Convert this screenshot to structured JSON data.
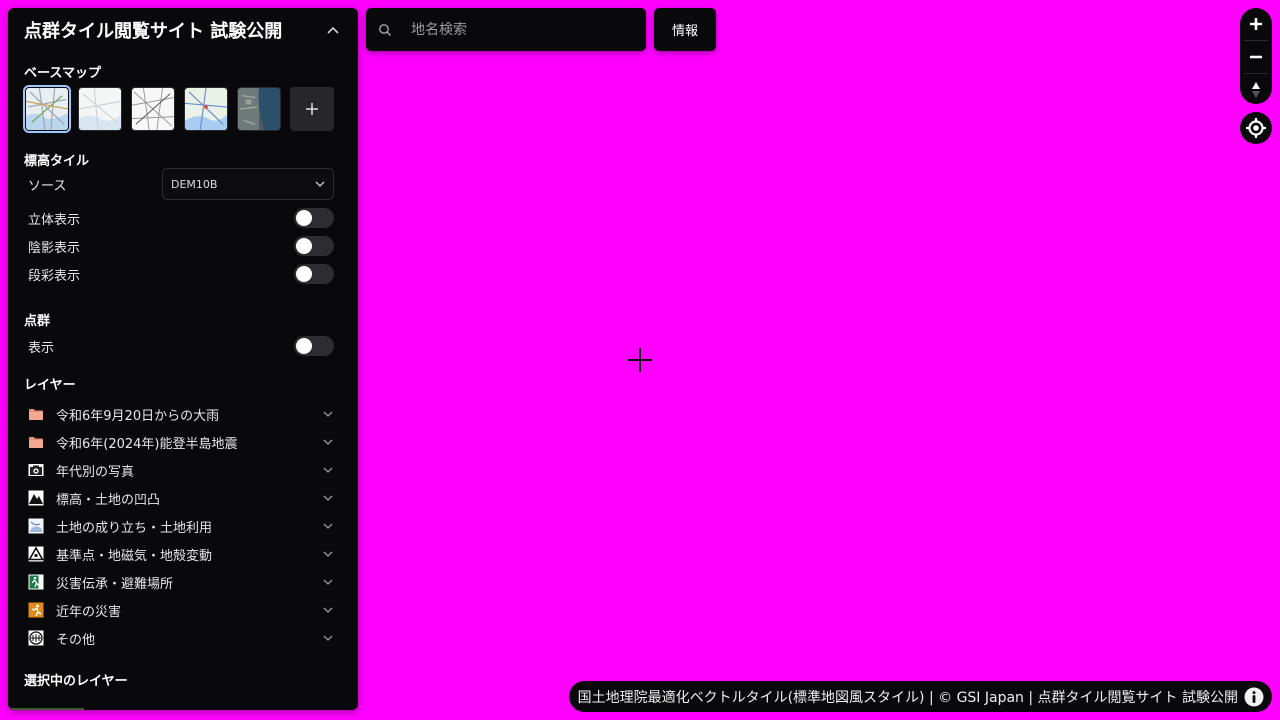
{
  "panel": {
    "title": "点群タイル閲覧サイト 試験公開",
    "basemap_heading": "ベースマップ",
    "elevation": {
      "heading": "標高タイル",
      "source_label": "ソース",
      "source_value": "DEM10B",
      "toggles": [
        {
          "label": "立体表示",
          "on": false
        },
        {
          "label": "陰影表示",
          "on": false
        },
        {
          "label": "段彩表示",
          "on": false
        }
      ]
    },
    "pointcloud": {
      "heading": "点群",
      "toggle_label": "表示",
      "on": false
    },
    "layers_heading": "レイヤー",
    "layers": [
      {
        "label": "令和6年9月20日からの大雨",
        "icon": "folder-icon"
      },
      {
        "label": "令和6年(2024年)能登半島地震",
        "icon": "folder-icon"
      },
      {
        "label": "年代別の写真",
        "icon": "camera-icon"
      },
      {
        "label": "標高・土地の凹凸",
        "icon": "mountain-icon"
      },
      {
        "label": "土地の成り立ち・土地利用",
        "icon": "landform-icon"
      },
      {
        "label": "基準点・地磁気・地殻変動",
        "icon": "triangulation-icon"
      },
      {
        "label": "災害伝承・避難場所",
        "icon": "evacuation-icon"
      },
      {
        "label": "近年の災害",
        "icon": "disaster-icon"
      },
      {
        "label": "その他",
        "icon": "other-icon"
      }
    ],
    "selected_layers_heading": "選択中のレイヤー"
  },
  "search": {
    "placeholder": "地名検索",
    "value": ""
  },
  "info_button": "情報",
  "attribution": "国土地理院最適化ベクトルタイル(標準地図風スタイル) | © GSI Japan | 点群タイル閲覧サイト 試験公開",
  "colors": {
    "map_background": "#ff00ff",
    "panel_background": "#09090c",
    "active_thumb_outline": "#9cc7ff"
  }
}
